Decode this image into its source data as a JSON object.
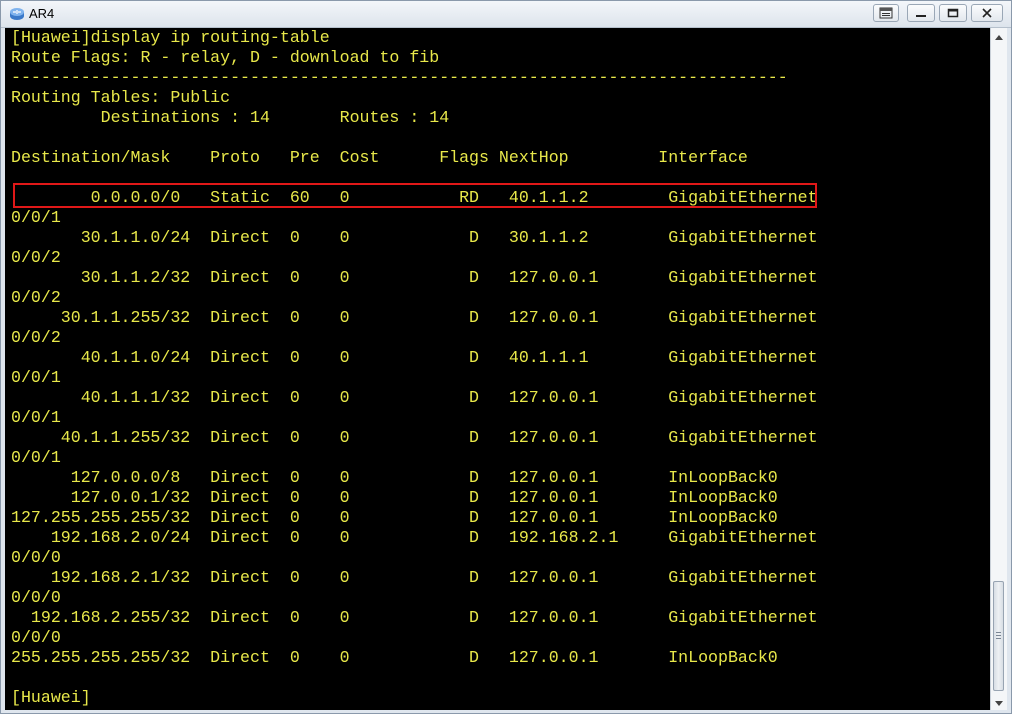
{
  "window": {
    "title": "AR4",
    "icons": {
      "app": "router-app-icon",
      "restore_ui": "restore-window-icon",
      "minimize": "minimize-icon",
      "maximize": "maximize-icon",
      "close": "close-icon"
    }
  },
  "terminal": {
    "text_color": "#e8e84a",
    "background": "#000000",
    "highlight_color": "#e01818",
    "lines": [
      "[Huawei]display ip routing-table",
      "Route Flags: R - relay, D - download to fib",
      "------------------------------------------------------------------------------",
      "Routing Tables: Public",
      "         Destinations : 14       Routes : 14",
      "",
      "Destination/Mask    Proto   Pre  Cost      Flags NextHop         Interface",
      "",
      "        0.0.0.0/0   Static  60   0           RD   40.1.1.2        GigabitEthernet",
      "0/0/1",
      "       30.1.1.0/24  Direct  0    0            D   30.1.1.2        GigabitEthernet",
      "0/0/2",
      "       30.1.1.2/32  Direct  0    0            D   127.0.0.1       GigabitEthernet",
      "0/0/2",
      "     30.1.1.255/32  Direct  0    0            D   127.0.0.1       GigabitEthernet",
      "0/0/2",
      "       40.1.1.0/24  Direct  0    0            D   40.1.1.1        GigabitEthernet",
      "0/0/1",
      "       40.1.1.1/32  Direct  0    0            D   127.0.0.1       GigabitEthernet",
      "0/0/1",
      "     40.1.1.255/32  Direct  0    0            D   127.0.0.1       GigabitEthernet",
      "0/0/1",
      "      127.0.0.0/8   Direct  0    0            D   127.0.0.1       InLoopBack0",
      "      127.0.0.1/32  Direct  0    0            D   127.0.0.1       InLoopBack0",
      "127.255.255.255/32  Direct  0    0            D   127.0.0.1       InLoopBack0",
      "    192.168.2.0/24  Direct  0    0            D   192.168.2.1     GigabitEthernet",
      "0/0/0",
      "    192.168.2.1/32  Direct  0    0            D   127.0.0.1       GigabitEthernet",
      "0/0/0",
      "  192.168.2.255/32  Direct  0    0            D   127.0.0.1       GigabitEthernet",
      "0/0/0",
      "255.255.255.255/32  Direct  0    0            D   127.0.0.1       InLoopBack0",
      "",
      "[Huawei]"
    ]
  }
}
